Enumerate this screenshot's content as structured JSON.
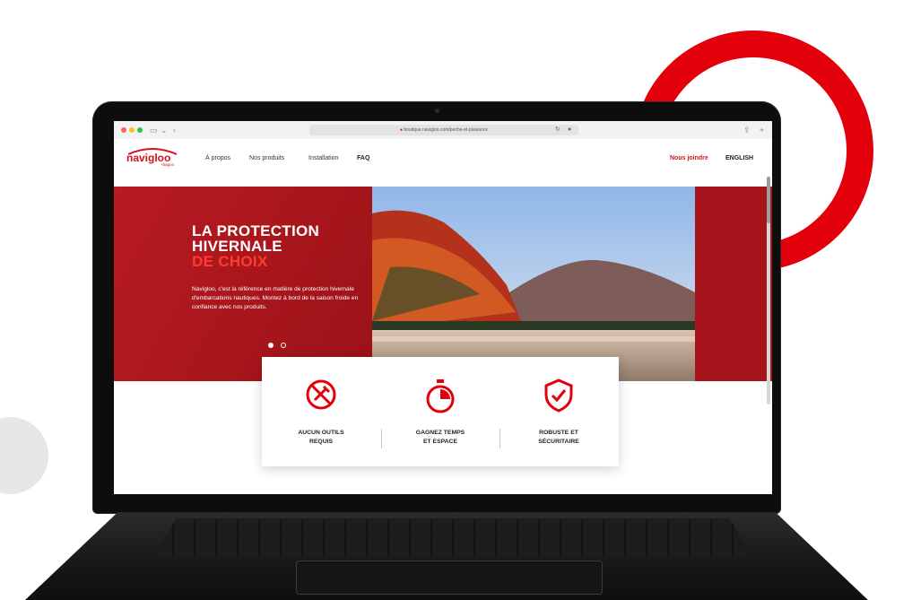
{
  "colors": {
    "brand_red": "#d0141d",
    "hero_red": "#a9161c"
  },
  "browser": {
    "url": "boutique.navigloo.com/peche-et-plaisance",
    "sidebar_icon": "sidebar-icon",
    "share_icon": "share-icon",
    "newtab_icon": "plus-icon"
  },
  "site": {
    "logo_text": "navigloo",
    "logo_sub": "+bagoo",
    "nav": {
      "about": "À propos",
      "products": "Nos produits",
      "installation": "Installation",
      "faq": "FAQ",
      "contact": "Nous joindre",
      "language": "ENGLISH"
    },
    "hero": {
      "title_line1": "LA PROTECTION",
      "title_line2": "HIVERNALE",
      "title_accent": "DE CHOIX",
      "body": "Navigloo, c'est la référence en matière de protection hivernale d'embarcations nautiques. Montez à bord de la saison froide en confiance avec nos produits."
    },
    "features": [
      {
        "icon": "no-tools-icon",
        "label_line1": "AUCUN OUTILS",
        "label_line2": "REQUIS"
      },
      {
        "icon": "stopwatch-icon",
        "label_line1": "GAGNEZ TEMPS",
        "label_line2": "ET ESPACE"
      },
      {
        "icon": "shield-check-icon",
        "label_line1": "ROBUSTE ET",
        "label_line2": "SÉCURITAIRE"
      }
    ]
  }
}
